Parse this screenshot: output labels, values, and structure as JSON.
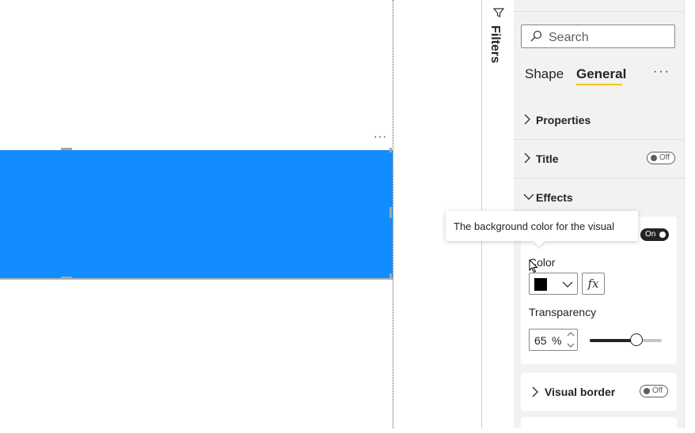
{
  "filters_pane": {
    "label": "Filters",
    "icon": "funnel-icon"
  },
  "visual": {
    "color": "#118dff",
    "more_icon": "···"
  },
  "format_pane": {
    "search": {
      "placeholder": "Search"
    },
    "tabs": [
      {
        "label": "Shape",
        "active": false
      },
      {
        "label": "General",
        "active": true
      }
    ],
    "more_icon": "···",
    "sections": {
      "properties": {
        "label": "Properties",
        "expanded": false
      },
      "title": {
        "label": "Title",
        "toggle": "Off"
      },
      "effects": {
        "label": "Effects",
        "expanded": true,
        "background": {
          "toggle": "On",
          "color_label": "Color",
          "color_value": "#000000",
          "fx_label": "fx",
          "transparency_label": "Transparency",
          "transparency_value": "65",
          "transparency_unit": "%",
          "transparency_fraction": 0.65
        }
      },
      "visual_border": {
        "label": "Visual border",
        "toggle": "Off"
      }
    }
  },
  "tooltip": {
    "text": "The background color for the visual"
  }
}
